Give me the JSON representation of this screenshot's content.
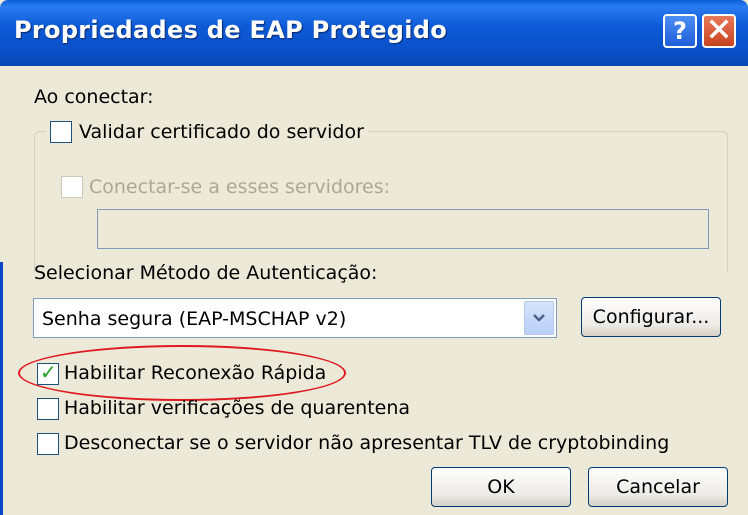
{
  "window": {
    "title": "Propriedades de EAP Protegido",
    "help_label": "?",
    "close_label": "✕"
  },
  "connect": {
    "heading": "Ao conectar:",
    "validate_cert": {
      "label": "Validar certificado do servidor",
      "checked": false
    },
    "connect_servers": {
      "label": "Conectar-se a esses servidores:",
      "checked": false,
      "enabled": false
    },
    "servers_value": ""
  },
  "auth": {
    "heading": "Selecionar Método de Autenticação:",
    "method_selected": "Senha segura (EAP-MSCHAP v2)",
    "configure_label": "Configurar..."
  },
  "options": [
    {
      "label": "Habilitar Reconexão Rápida",
      "checked": true
    },
    {
      "label": "Habilitar verificações de quarentena",
      "checked": false
    },
    {
      "label": "Desconectar se o servidor não apresentar TLV de cryptobinding",
      "checked": false
    }
  ],
  "buttons": {
    "ok": "OK",
    "cancel": "Cancelar"
  },
  "colors": {
    "titlebar": "#0a5fd8",
    "dialog_bg": "#ece9d8",
    "highlight": "#e0191f"
  }
}
